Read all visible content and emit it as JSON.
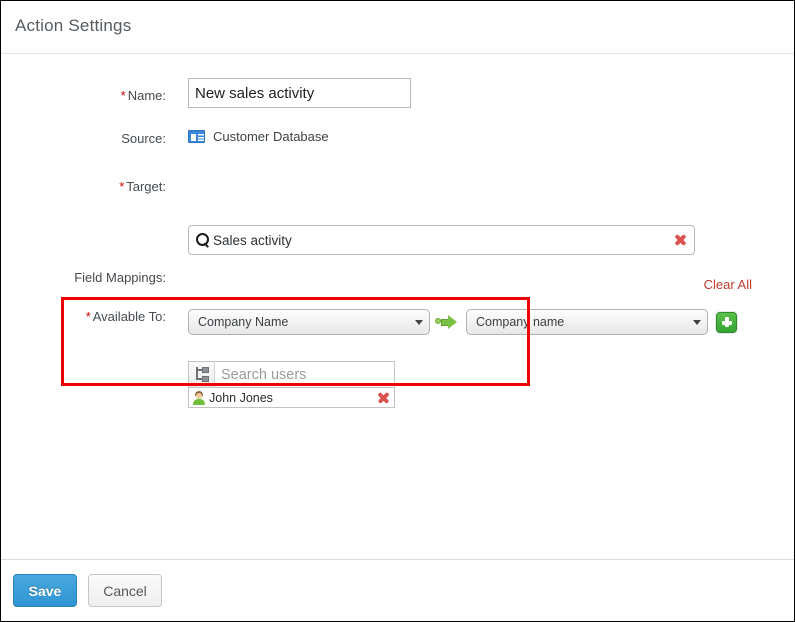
{
  "header": {
    "title": "Action Settings"
  },
  "form": {
    "name": {
      "label": "Name:",
      "required_marker": "*",
      "value": "New sales activity",
      "placeholder": ""
    },
    "source": {
      "label": "Source:",
      "icon": "contact-card-icon",
      "value": "Customer Database"
    },
    "target": {
      "label": "Target:",
      "required_marker": "*",
      "icon": "search-icon",
      "value": "Sales activity",
      "clear_icon": "red-x-icon"
    },
    "field_mappings": {
      "label": "Field Mappings:",
      "clear_all_label": "Clear All",
      "arrow_icon": "green-arrow-right-icon",
      "add_icon": "green-plus-icon",
      "rows": [
        {
          "source_field": "Company Name",
          "target_field": "Company name"
        }
      ]
    },
    "available_to": {
      "label": "Available To:",
      "required_marker": "*",
      "tree_icon": "org-tree-icon",
      "search_placeholder": "Search users",
      "search_value": "",
      "users": [
        {
          "name": "John Jones",
          "avatar_icon": "user-avatar-icon",
          "remove_icon": "red-x-icon"
        }
      ]
    }
  },
  "footer": {
    "save_label": "Save",
    "cancel_label": "Cancel"
  },
  "colors": {
    "required_red": "#cc0000",
    "highlight_red": "#ee0000",
    "clear_all_red": "#c0392b",
    "save_blue": "#2e95d3",
    "accent_green": "#34a434"
  }
}
